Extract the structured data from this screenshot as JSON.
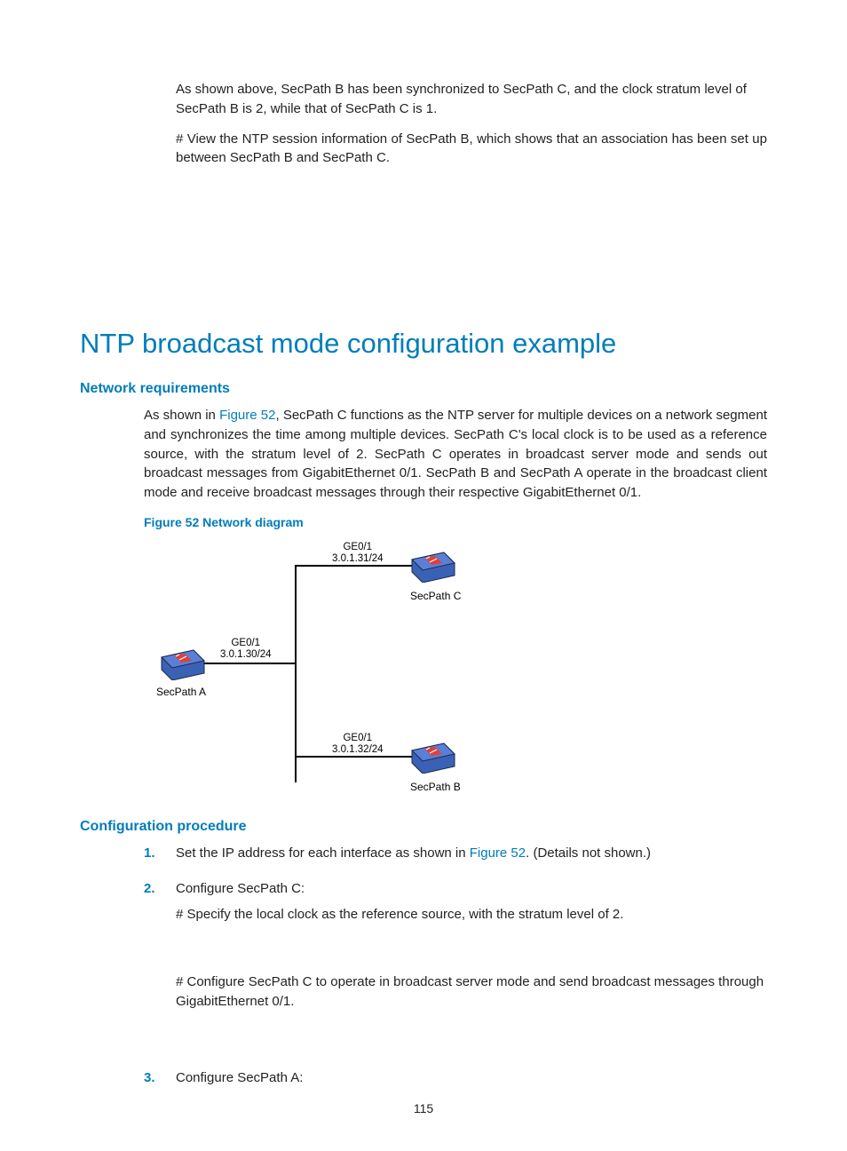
{
  "intro": {
    "p1": "As shown above, SecPath B has been synchronized to SecPath C, and the clock stratum level of SecPath B is 2, while that of SecPath C is 1.",
    "p2": "# View the NTP session information of SecPath B, which shows that an association has been set up between SecPath B and SecPath C."
  },
  "heading": "NTP broadcast mode configuration example",
  "net_req": {
    "title": "Network requirements",
    "pre": "As shown in ",
    "link": "Figure 52",
    "post": ", SecPath C functions as the NTP server for multiple devices on a network segment and synchronizes the time among multiple devices. SecPath C's local clock is to be used as a reference source, with the stratum level of 2. SecPath C operates in broadcast server mode and sends out broadcast messages from GigabitEthernet 0/1. SecPath B and SecPath A operate in the broadcast client mode and receive broadcast messages through their respective GigabitEthernet 0/1."
  },
  "figure_caption": "Figure 52 Network diagram",
  "diagram": {
    "nodeC": {
      "name": "SecPath C",
      "iface": "GE0/1",
      "ip": "3.0.1.31/24"
    },
    "nodeA": {
      "name": "SecPath A",
      "iface": "GE0/1",
      "ip": "3.0.1.30/24"
    },
    "nodeB": {
      "name": "SecPath B",
      "iface": "GE0/1",
      "ip": "3.0.1.32/24"
    }
  },
  "proc": {
    "title": "Configuration procedure",
    "step1_pre": "Set the IP address for each interface as shown in ",
    "step1_link": "Figure 52",
    "step1_post": ". (Details not shown.)",
    "step2_a": "Configure SecPath C:",
    "step2_b": "# Specify the local clock as the reference source, with the stratum level of 2.",
    "step2_c": "# Configure SecPath C to operate in broadcast server mode and send broadcast messages through GigabitEthernet 0/1.",
    "step3": "Configure SecPath A:"
  },
  "page_number": "115"
}
